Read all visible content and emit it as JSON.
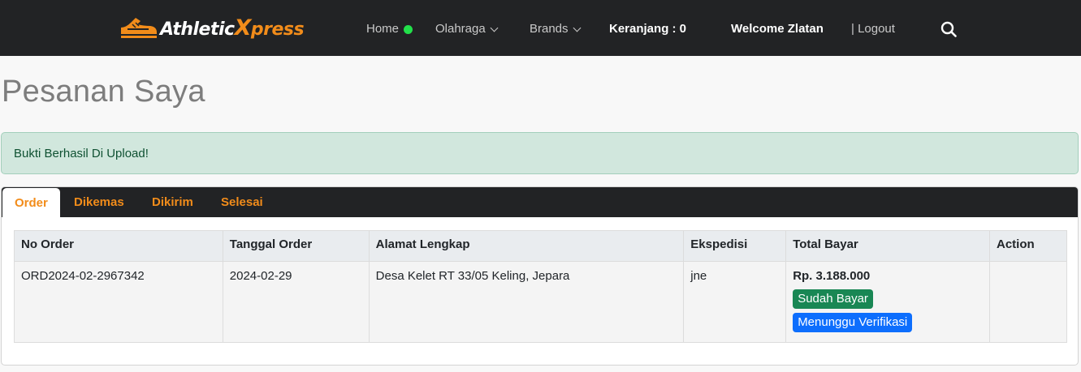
{
  "brand": {
    "prefix": "Athletic",
    "x": "X",
    "rest": "press"
  },
  "nav": {
    "home": "Home",
    "olahraga": "Olahraga",
    "brands": "Brands",
    "cart": "Keranjang : 0",
    "welcome": "Welcome Zlatan",
    "logout": "| Logout",
    "online_color": "#22e04a"
  },
  "page": {
    "title": "Pesanan Saya"
  },
  "alert": {
    "message": "Bukti Berhasil Di Upload!"
  },
  "tabs": [
    {
      "label": "Order",
      "active": true
    },
    {
      "label": "Dikemas",
      "active": false
    },
    {
      "label": "Dikirim",
      "active": false
    },
    {
      "label": "Selesai",
      "active": false
    }
  ],
  "table": {
    "headers": [
      "No Order",
      "Tanggal Order",
      "Alamat Lengkap",
      "Ekspedisi",
      "Total Bayar",
      "Action"
    ],
    "rows": [
      {
        "no_order": "ORD2024-02-2967342",
        "tanggal": "2024-02-29",
        "alamat": "Desa Kelet RT 33/05 Keling, Jepara",
        "ekspedisi": "jne",
        "total": "Rp. 3.188.000",
        "payment_status": "Sudah Bayar",
        "verify_status": "Menunggu Verifikasi",
        "action": ""
      }
    ]
  },
  "colors": {
    "accent": "#f28c1a",
    "navbar": "#222325",
    "success": "#198754",
    "primary": "#0d6efd"
  }
}
